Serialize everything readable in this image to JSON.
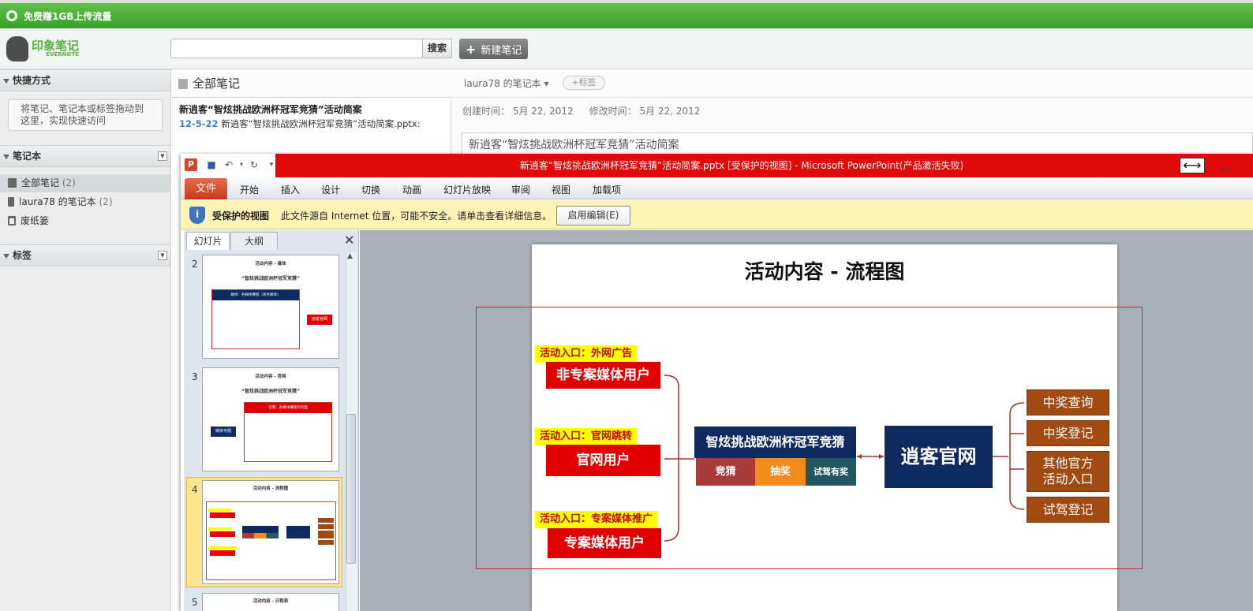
{
  "promo": {
    "text": "免费赚1GB上传流量"
  },
  "logo": {
    "name": "印象笔记",
    "sub": "EVERNOTE"
  },
  "toolbar": {
    "search_placeholder": "",
    "search_label": "搜索",
    "new_note_label": "新建笔记"
  },
  "sidebar": {
    "shortcuts_header": "快捷方式",
    "shortcuts_hint": "将笔记、笔记本或标签拖动到这里，实现快速访问",
    "notebooks_header": "笔记本",
    "notebooks": [
      {
        "label": "全部笔记",
        "count": "(2)"
      },
      {
        "label": "laura78 的笔记本",
        "count": "(2)"
      },
      {
        "label": "废纸篓",
        "count": ""
      }
    ],
    "tags_header": "标签"
  },
  "notelist": {
    "header": "全部笔记",
    "items": [
      {
        "title": "新逍客“智炫挑战欧洲杯冠军竞猜”活动简案",
        "date": "12-5-22",
        "snippet": "新逍客“智炫挑战欧洲杯冠军竞猜”活动简案.pptx:"
      }
    ]
  },
  "editor": {
    "notebook": "laura78 的笔记本 ▾",
    "tag_pill": "+标签",
    "created": "创建时间： 5月 22, 2012",
    "modified": "修改时间： 5月 22, 2012",
    "title": "新逍客“智炫挑战欧洲杯冠军竞猜”活动简案"
  },
  "ppt": {
    "window_title": "新逍客“智炫挑战欧洲杯冠军竞猜”活动简案.pptx [受保护的视图] - Microsoft PowerPoint(产品激活失败)",
    "tabs": [
      "文件",
      "开始",
      "插入",
      "设计",
      "切换",
      "动画",
      "幻灯片放映",
      "审阅",
      "视图",
      "加载项"
    ],
    "protected_label": "受保护的视图",
    "protected_msg": "此文件源自 Internet 位置，可能不安全。请单击查看详细信息。",
    "enable_btn": "启用编辑(E)",
    "pane_tabs": [
      "幻灯片",
      "大纲"
    ],
    "thumbs": [
      {
        "num": "2",
        "title": "活动内容 - 媒体",
        "subtitle": "“智炫挑战欧洲杯冠军竞猜”",
        "header": "媒体：各媒体赛程（商务媒体）",
        "tag": "逍客官网"
      },
      {
        "num": "3",
        "title": "活动内容 - 官网",
        "subtitle": "“智炫挑战欧洲杯冠军竞猜”",
        "header": "官网：各媒体赛程的页面",
        "tag": "媒体专题"
      },
      {
        "num": "4",
        "title": "活动内容 - 流程图"
      },
      {
        "num": "5",
        "title": "活动内容 - 日程表"
      }
    ],
    "slide": {
      "title": "活动内容 - 流程图",
      "entries": [
        {
          "label": "活动入口：外网广告",
          "box": "非专案媒体用户"
        },
        {
          "label": "活动入口：官网跳转",
          "box": "官网用户"
        },
        {
          "label": "活动入口：专案媒体推广",
          "box": "专案媒体用户"
        }
      ],
      "center": "智炫挑战欧洲杯冠军竞猜",
      "sub": [
        "竞猜",
        "抽奖",
        "试驾有奖"
      ],
      "site": "逍客官网",
      "outputs": [
        "中奖查询",
        "中奖登记",
        "其他官方活动入口",
        "试驾登记"
      ]
    }
  },
  "colors": {
    "promo_green": "#3da52e",
    "ppt_red": "#e00a0a",
    "navy": "#0e2a5f",
    "orange_brown": "#a14a12"
  }
}
